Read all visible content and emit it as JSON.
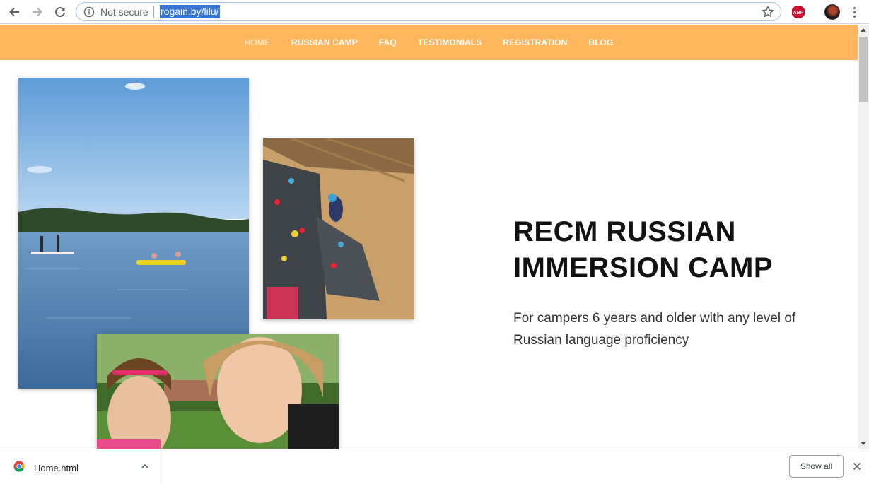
{
  "browser": {
    "security_label": "Not secure",
    "url": "rogain.by/lilu/",
    "extension_label": "ABP"
  },
  "site_nav": {
    "items": [
      {
        "label": "HOME",
        "active": true
      },
      {
        "label": "RUSSIAN CAMP"
      },
      {
        "label": "FAQ"
      },
      {
        "label": "TESTIMONIALS"
      },
      {
        "label": "REGISTRATION"
      },
      {
        "label": "BLOG"
      }
    ],
    "color": "#ffb65c"
  },
  "hero": {
    "title": "RECM RUSSIAN IMMERSION CAMP",
    "subtitle": "For campers 6 years and older with any level of Russian language proficiency"
  },
  "download_shelf": {
    "file_name": "Home.html",
    "show_all_label": "Show all"
  }
}
